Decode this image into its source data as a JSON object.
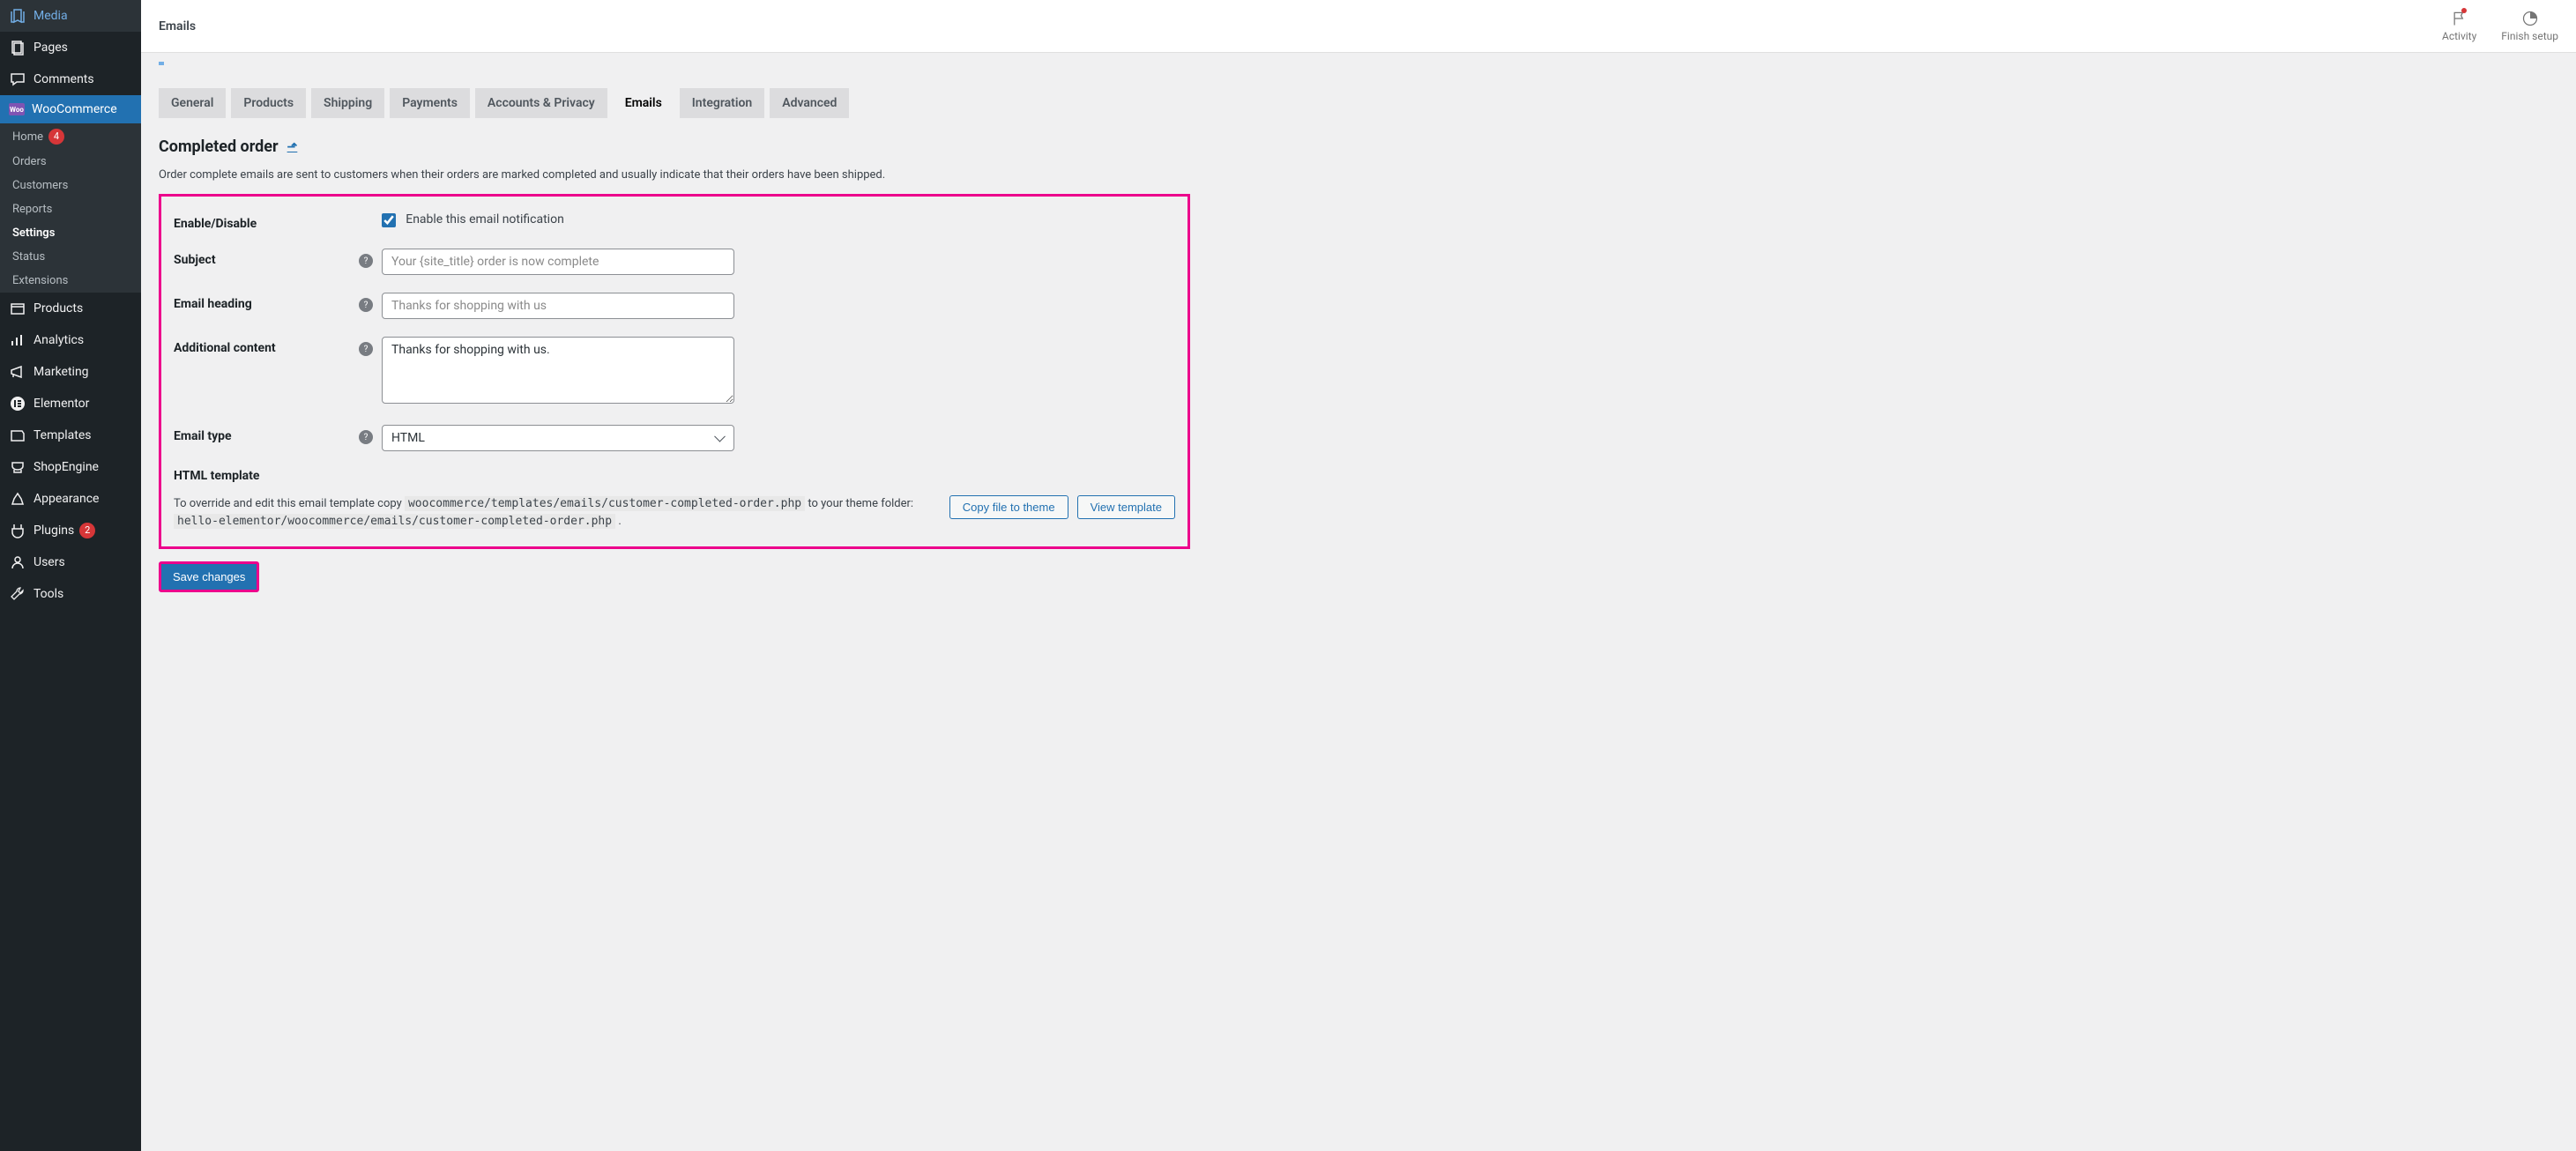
{
  "sidebar": {
    "items": [
      {
        "icon": "media",
        "label": "Media"
      },
      {
        "icon": "pages",
        "label": "Pages"
      },
      {
        "icon": "comments",
        "label": "Comments"
      },
      {
        "icon": "woo",
        "label": "WooCommerce",
        "active": true
      },
      {
        "icon": "products",
        "label": "Products"
      },
      {
        "icon": "analytics",
        "label": "Analytics"
      },
      {
        "icon": "marketing",
        "label": "Marketing"
      },
      {
        "icon": "elementor",
        "label": "Elementor"
      },
      {
        "icon": "templates",
        "label": "Templates"
      },
      {
        "icon": "shopengine",
        "label": "ShopEngine"
      },
      {
        "icon": "appearance",
        "label": "Appearance"
      },
      {
        "icon": "plugins",
        "label": "Plugins",
        "badge": "2"
      },
      {
        "icon": "users",
        "label": "Users"
      },
      {
        "icon": "tools",
        "label": "Tools"
      }
    ],
    "submenu": [
      {
        "label": "Home",
        "badge": "4"
      },
      {
        "label": "Orders"
      },
      {
        "label": "Customers"
      },
      {
        "label": "Reports"
      },
      {
        "label": "Settings",
        "current": true
      },
      {
        "label": "Status"
      },
      {
        "label": "Extensions"
      }
    ]
  },
  "topbar": {
    "title": "Emails",
    "activity_label": "Activity",
    "finish_label": "Finish setup"
  },
  "tabs": [
    "General",
    "Products",
    "Shipping",
    "Payments",
    "Accounts & Privacy",
    "Emails",
    "Integration",
    "Advanced"
  ],
  "active_tab_index": 5,
  "page": {
    "heading": "Completed order",
    "back": "⬏",
    "desc": "Order complete emails are sent to customers when their orders are marked completed and usually indicate that their orders have been shipped."
  },
  "form": {
    "enable_label": "Enable/Disable",
    "enable_cb_label": "Enable this email notification",
    "enable_checked": true,
    "subject_label": "Subject",
    "subject_placeholder": "Your {site_title} order is now complete",
    "subject_value": "",
    "heading_label": "Email heading",
    "heading_placeholder": "Thanks for shopping with us",
    "heading_value": "",
    "additional_label": "Additional content",
    "additional_value": "Thanks for shopping with us.",
    "type_label": "Email type",
    "type_value": "HTML",
    "template_header": "HTML template",
    "template_prefix": "To override and edit this email template copy ",
    "template_code1": "woocommerce/templates/emails/customer-completed-order.php",
    "template_mid": " to your theme folder: ",
    "template_code2": "hello-elementor/woocommerce/emails/customer-completed-order.php",
    "template_suffix": " .",
    "copy_btn": "Copy file to theme",
    "view_btn": "View template"
  },
  "save_label": "Save changes"
}
